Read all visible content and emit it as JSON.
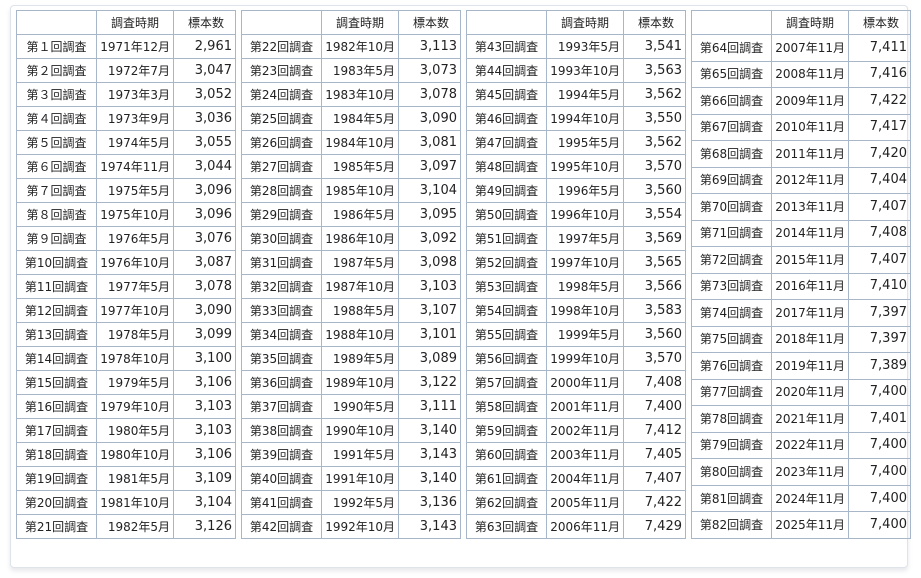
{
  "headers": {
    "name": "",
    "period": "調査時期",
    "sample": "標本数"
  },
  "tables": [
    {
      "rows": [
        {
          "name": "第１回調査",
          "period": "1971年12月",
          "sample": "2,961"
        },
        {
          "name": "第２回調査",
          "period": "1972年7月",
          "sample": "3,047"
        },
        {
          "name": "第３回調査",
          "period": "1973年3月",
          "sample": "3,052"
        },
        {
          "name": "第４回調査",
          "period": "1973年9月",
          "sample": "3,036"
        },
        {
          "name": "第５回調査",
          "period": "1974年5月",
          "sample": "3,055"
        },
        {
          "name": "第６回調査",
          "period": "1974年11月",
          "sample": "3,044"
        },
        {
          "name": "第７回調査",
          "period": "1975年5月",
          "sample": "3,096"
        },
        {
          "name": "第８回調査",
          "period": "1975年10月",
          "sample": "3,096"
        },
        {
          "name": "第９回調査",
          "period": "1976年5月",
          "sample": "3,076"
        },
        {
          "name": "第10回調査",
          "period": "1976年10月",
          "sample": "3,087"
        },
        {
          "name": "第11回調査",
          "period": "1977年5月",
          "sample": "3,078"
        },
        {
          "name": "第12回調査",
          "period": "1977年10月",
          "sample": "3,090"
        },
        {
          "name": "第13回調査",
          "period": "1978年5月",
          "sample": "3,099"
        },
        {
          "name": "第14回調査",
          "period": "1978年10月",
          "sample": "3,100"
        },
        {
          "name": "第15回調査",
          "period": "1979年5月",
          "sample": "3,106"
        },
        {
          "name": "第16回調査",
          "period": "1979年10月",
          "sample": "3,103"
        },
        {
          "name": "第17回調査",
          "period": "1980年5月",
          "sample": "3,103"
        },
        {
          "name": "第18回調査",
          "period": "1980年10月",
          "sample": "3,106"
        },
        {
          "name": "第19回調査",
          "period": "1981年5月",
          "sample": "3,109"
        },
        {
          "name": "第20回調査",
          "period": "1981年10月",
          "sample": "3,104"
        },
        {
          "name": "第21回調査",
          "period": "1982年5月",
          "sample": "3,126"
        }
      ]
    },
    {
      "rows": [
        {
          "name": "第22回調査",
          "period": "1982年10月",
          "sample": "3,113"
        },
        {
          "name": "第23回調査",
          "period": "1983年5月",
          "sample": "3,073"
        },
        {
          "name": "第24回調査",
          "period": "1983年10月",
          "sample": "3,078"
        },
        {
          "name": "第25回調査",
          "period": "1984年5月",
          "sample": "3,090"
        },
        {
          "name": "第26回調査",
          "period": "1984年10月",
          "sample": "3,081"
        },
        {
          "name": "第27回調査",
          "period": "1985年5月",
          "sample": "3,097"
        },
        {
          "name": "第28回調査",
          "period": "1985年10月",
          "sample": "3,104"
        },
        {
          "name": "第29回調査",
          "period": "1986年5月",
          "sample": "3,095"
        },
        {
          "name": "第30回調査",
          "period": "1986年10月",
          "sample": "3,092"
        },
        {
          "name": "第31回調査",
          "period": "1987年5月",
          "sample": "3,098"
        },
        {
          "name": "第32回調査",
          "period": "1987年10月",
          "sample": "3,103"
        },
        {
          "name": "第33回調査",
          "period": "1988年5月",
          "sample": "3,107"
        },
        {
          "name": "第34回調査",
          "period": "1988年10月",
          "sample": "3,101"
        },
        {
          "name": "第35回調査",
          "period": "1989年5月",
          "sample": "3,089"
        },
        {
          "name": "第36回調査",
          "period": "1989年10月",
          "sample": "3,122"
        },
        {
          "name": "第37回調査",
          "period": "1990年5月",
          "sample": "3,111"
        },
        {
          "name": "第38回調査",
          "period": "1990年10月",
          "sample": "3,140"
        },
        {
          "name": "第39回調査",
          "period": "1991年5月",
          "sample": "3,143"
        },
        {
          "name": "第40回調査",
          "period": "1991年10月",
          "sample": "3,140"
        },
        {
          "name": "第41回調査",
          "period": "1992年5月",
          "sample": "3,136"
        },
        {
          "name": "第42回調査",
          "period": "1992年10月",
          "sample": "3,143"
        }
      ]
    },
    {
      "rows": [
        {
          "name": "第43回調査",
          "period": "1993年5月",
          "sample": "3,541"
        },
        {
          "name": "第44回調査",
          "period": "1993年10月",
          "sample": "3,563"
        },
        {
          "name": "第45回調査",
          "period": "1994年5月",
          "sample": "3,562"
        },
        {
          "name": "第46回調査",
          "period": "1994年10月",
          "sample": "3,550"
        },
        {
          "name": "第47回調査",
          "period": "1995年5月",
          "sample": "3,562"
        },
        {
          "name": "第48回調査",
          "period": "1995年10月",
          "sample": "3,570"
        },
        {
          "name": "第49回調査",
          "period": "1996年5月",
          "sample": "3,560"
        },
        {
          "name": "第50回調査",
          "period": "1996年10月",
          "sample": "3,554"
        },
        {
          "name": "第51回調査",
          "period": "1997年5月",
          "sample": "3,569"
        },
        {
          "name": "第52回調査",
          "period": "1997年10月",
          "sample": "3,565"
        },
        {
          "name": "第53回調査",
          "period": "1998年5月",
          "sample": "3,566"
        },
        {
          "name": "第54回調査",
          "period": "1998年10月",
          "sample": "3,583"
        },
        {
          "name": "第55回調査",
          "period": "1999年5月",
          "sample": "3,560"
        },
        {
          "name": "第56回調査",
          "period": "1999年10月",
          "sample": "3,570"
        },
        {
          "name": "第57回調査",
          "period": "2000年11月",
          "sample": "7,408"
        },
        {
          "name": "第58回調査",
          "period": "2001年11月",
          "sample": "7,400"
        },
        {
          "name": "第59回調査",
          "period": "2002年11月",
          "sample": "7,412"
        },
        {
          "name": "第60回調査",
          "period": "2003年11月",
          "sample": "7,405"
        },
        {
          "name": "第61回調査",
          "period": "2004年11月",
          "sample": "7,407"
        },
        {
          "name": "第62回調査",
          "period": "2005年11月",
          "sample": "7,422"
        },
        {
          "name": "第63回調査",
          "period": "2006年11月",
          "sample": "7,429"
        }
      ]
    },
    {
      "rows": [
        {
          "name": "第64回調査",
          "period": "2007年11月",
          "sample": "7,411"
        },
        {
          "name": "第65回調査",
          "period": "2008年11月",
          "sample": "7,416"
        },
        {
          "name": "第66回調査",
          "period": "2009年11月",
          "sample": "7,422"
        },
        {
          "name": "第67回調査",
          "period": "2010年11月",
          "sample": "7,417"
        },
        {
          "name": "第68回調査",
          "period": "2011年11月",
          "sample": "7,420"
        },
        {
          "name": "第69回調査",
          "period": "2012年11月",
          "sample": "7,404"
        },
        {
          "name": "第70回調査",
          "period": "2013年11月",
          "sample": "7,407"
        },
        {
          "name": "第71回調査",
          "period": "2014年11月",
          "sample": "7,408"
        },
        {
          "name": "第72回調査",
          "period": "2015年11月",
          "sample": "7,407"
        },
        {
          "name": "第73回調査",
          "period": "2016年11月",
          "sample": "7,410"
        },
        {
          "name": "第74回調査",
          "period": "2017年11月",
          "sample": "7,397"
        },
        {
          "name": "第75回調査",
          "period": "2018年11月",
          "sample": "7,397"
        },
        {
          "name": "第76回調査",
          "period": "2019年11月",
          "sample": "7,389"
        },
        {
          "name": "第77回調査",
          "period": "2020年11月",
          "sample": "7,400"
        },
        {
          "name": "第78回調査",
          "period": "2021年11月",
          "sample": "7,401"
        },
        {
          "name": "第79回調査",
          "period": "2022年11月",
          "sample": "7,400"
        },
        {
          "name": "第80回調査",
          "period": "2023年11月",
          "sample": "7,400"
        },
        {
          "name": "第81回調査",
          "period": "2024年11月",
          "sample": "7,400"
        },
        {
          "name": "第82回調査",
          "period": "2025年11月",
          "sample": "7,400"
        }
      ]
    }
  ]
}
